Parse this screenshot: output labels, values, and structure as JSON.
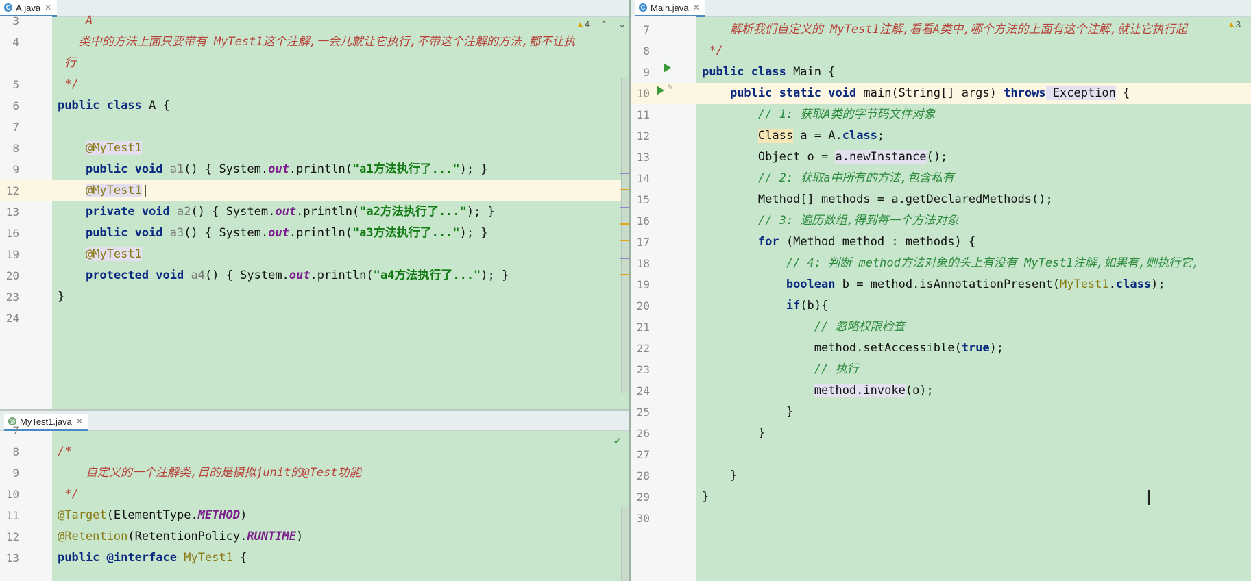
{
  "left_top": {
    "tab": {
      "label": "A.java",
      "icon": "C"
    },
    "warnings": "4",
    "lines": [
      {
        "n": "3",
        "segments": [
          {
            "t": "    A",
            "c": "cm"
          }
        ]
      },
      {
        "n": "4",
        "segments": [
          {
            "t": "   类中的方法上面只要带有 MyTest1这个注解,一会儿就让它执行,不带这个注解的方法,都不让执",
            "c": "cm"
          }
        ]
      },
      {
        "n": "",
        "segments": [
          {
            "t": " 行",
            "c": "cm"
          }
        ]
      },
      {
        "n": "5",
        "segments": [
          {
            "t": " */",
            "c": "cm"
          }
        ]
      },
      {
        "n": "6",
        "segments": [
          {
            "t": "public class",
            "c": "kw"
          },
          {
            "t": " A {",
            "c": ""
          }
        ]
      },
      {
        "n": "7",
        "segments": [
          {
            "t": "",
            "c": ""
          }
        ]
      },
      {
        "n": "8",
        "segments": [
          {
            "t": "    ",
            "c": ""
          },
          {
            "t": "@MyTest1",
            "c": "annbg"
          }
        ]
      },
      {
        "n": "9",
        "segments": [
          {
            "t": "    ",
            "c": ""
          },
          {
            "t": "public void",
            "c": "kw"
          },
          {
            "t": " a1",
            "c": "gray"
          },
          {
            "t": "() { System.",
            "c": ""
          },
          {
            "t": "out",
            "c": "fld"
          },
          {
            "t": ".println(",
            "c": ""
          },
          {
            "t": "\"a1方法执行了...\"",
            "c": "str"
          },
          {
            "t": "); }",
            "c": ""
          }
        ]
      },
      {
        "n": "12",
        "segments": [
          {
            "t": "    ",
            "c": ""
          },
          {
            "t": "@MyTest1",
            "c": "annbg"
          },
          {
            "t": "|",
            "c": ""
          }
        ]
      },
      {
        "n": "13",
        "segments": [
          {
            "t": "    ",
            "c": ""
          },
          {
            "t": "private void",
            "c": "kw"
          },
          {
            "t": " a2",
            "c": "gray"
          },
          {
            "t": "() { System.",
            "c": ""
          },
          {
            "t": "out",
            "c": "fld"
          },
          {
            "t": ".println(",
            "c": ""
          },
          {
            "t": "\"a2方法执行了...\"",
            "c": "str"
          },
          {
            "t": "); }",
            "c": ""
          }
        ]
      },
      {
        "n": "16",
        "segments": [
          {
            "t": "    ",
            "c": ""
          },
          {
            "t": "public void",
            "c": "kw"
          },
          {
            "t": " a3",
            "c": "gray"
          },
          {
            "t": "() { System.",
            "c": ""
          },
          {
            "t": "out",
            "c": "fld"
          },
          {
            "t": ".println(",
            "c": ""
          },
          {
            "t": "\"a3方法执行了...\"",
            "c": "str"
          },
          {
            "t": "); }",
            "c": ""
          }
        ]
      },
      {
        "n": "19",
        "segments": [
          {
            "t": "    ",
            "c": ""
          },
          {
            "t": "@MyTest1",
            "c": "annbg"
          }
        ]
      },
      {
        "n": "20",
        "segments": [
          {
            "t": "    ",
            "c": ""
          },
          {
            "t": "protected void",
            "c": "kw"
          },
          {
            "t": " a4",
            "c": "gray"
          },
          {
            "t": "() { System.",
            "c": ""
          },
          {
            "t": "out",
            "c": "fld"
          },
          {
            "t": ".println(",
            "c": ""
          },
          {
            "t": "\"a4方法执行了...\"",
            "c": "str"
          },
          {
            "t": "); }",
            "c": ""
          }
        ]
      },
      {
        "n": "23",
        "segments": [
          {
            "t": "}",
            "c": ""
          }
        ]
      },
      {
        "n": "24",
        "segments": [
          {
            "t": "",
            "c": ""
          }
        ]
      }
    ]
  },
  "left_bottom": {
    "tab": {
      "label": "MyTest1.java",
      "icon": "@"
    },
    "lines": [
      {
        "n": "7",
        "segments": [
          {
            "t": "",
            "c": ""
          }
        ]
      },
      {
        "n": "8",
        "segments": [
          {
            "t": "/*",
            "c": "cm"
          }
        ]
      },
      {
        "n": "9",
        "segments": [
          {
            "t": "    自定义的一个注解类,目的是模拟junit的@Test功能",
            "c": "cm"
          }
        ]
      },
      {
        "n": "10",
        "segments": [
          {
            "t": " */",
            "c": "cm"
          }
        ]
      },
      {
        "n": "11",
        "segments": [
          {
            "t": "@Target",
            "c": "ann"
          },
          {
            "t": "(ElementType.",
            "c": ""
          },
          {
            "t": "METHOD",
            "c": "fld"
          },
          {
            "t": ")",
            "c": ""
          }
        ]
      },
      {
        "n": "12",
        "segments": [
          {
            "t": "@Retention",
            "c": "ann"
          },
          {
            "t": "(RetentionPolicy.",
            "c": ""
          },
          {
            "t": "RUNTIME",
            "c": "fld"
          },
          {
            "t": ")",
            "c": ""
          }
        ]
      },
      {
        "n": "13",
        "segments": [
          {
            "t": "public",
            "c": "kw"
          },
          {
            "t": " @interface",
            "c": "kw"
          },
          {
            "t": " MyTest1",
            "c": "ann"
          },
          {
            "t": " {",
            "c": ""
          }
        ]
      }
    ]
  },
  "right": {
    "tab": {
      "label": "Main.java",
      "icon": "C"
    },
    "warnings": "3",
    "lines": [
      {
        "n": "7",
        "segments": [
          {
            "t": "    解析我们自定义的 MyTest1注解,看看A类中,哪个方法的上面有这个注解,就让它执行起",
            "c": "cm"
          }
        ]
      },
      {
        "n": "8",
        "segments": [
          {
            "t": " */",
            "c": "cm"
          }
        ]
      },
      {
        "n": "9",
        "segments": [
          {
            "t": "public class",
            "c": "kw"
          },
          {
            "t": " Main {",
            "c": ""
          }
        ]
      },
      {
        "n": "10",
        "segments": [
          {
            "t": "    ",
            "c": ""
          },
          {
            "t": "public static void",
            "c": "kw"
          },
          {
            "t": " main(String[] args) ",
            "c": ""
          },
          {
            "t": "throws",
            "c": "kw"
          },
          {
            "t": " Exception",
            "c": "lilac"
          },
          {
            "t": " {",
            "c": ""
          }
        ]
      },
      {
        "n": "11",
        "segments": [
          {
            "t": "        ",
            "c": ""
          },
          {
            "t": "// 1: 获取A类的字节码文件对象",
            "c": "gc"
          }
        ]
      },
      {
        "n": "12",
        "segments": [
          {
            "t": "        ",
            "c": ""
          },
          {
            "t": "Class",
            "c": "warnbg"
          },
          {
            "t": " a = A.",
            "c": ""
          },
          {
            "t": "class",
            "c": "kw"
          },
          {
            "t": ";",
            "c": ""
          }
        ]
      },
      {
        "n": "13",
        "segments": [
          {
            "t": "        Object o = ",
            "c": ""
          },
          {
            "t": "a.newInstance",
            "c": "lilac"
          },
          {
            "t": "();",
            "c": ""
          }
        ]
      },
      {
        "n": "14",
        "segments": [
          {
            "t": "        ",
            "c": ""
          },
          {
            "t": "// 2: 获取a中所有的方法,包含私有",
            "c": "gc"
          }
        ]
      },
      {
        "n": "15",
        "segments": [
          {
            "t": "        Method[] methods = a.getDeclaredMethods();",
            "c": ""
          }
        ]
      },
      {
        "n": "16",
        "segments": [
          {
            "t": "        ",
            "c": ""
          },
          {
            "t": "// 3: 遍历数组,得到每一个方法对象",
            "c": "gc"
          }
        ]
      },
      {
        "n": "17",
        "segments": [
          {
            "t": "        ",
            "c": ""
          },
          {
            "t": "for",
            "c": "kw"
          },
          {
            "t": " (Method method : methods) {",
            "c": ""
          }
        ]
      },
      {
        "n": "18",
        "segments": [
          {
            "t": "            ",
            "c": ""
          },
          {
            "t": "// 4: 判断 method方法对象的头上有没有 MyTest1注解,如果有,则执行它,",
            "c": "gc"
          }
        ]
      },
      {
        "n": "19",
        "segments": [
          {
            "t": "            ",
            "c": ""
          },
          {
            "t": "boolean",
            "c": "kw"
          },
          {
            "t": " b = method.isAnnotationPresent(",
            "c": ""
          },
          {
            "t": "MyTest1",
            "c": "ann"
          },
          {
            "t": ".",
            "c": ""
          },
          {
            "t": "class",
            "c": "kw"
          },
          {
            "t": ");",
            "c": ""
          }
        ]
      },
      {
        "n": "20",
        "segments": [
          {
            "t": "            ",
            "c": ""
          },
          {
            "t": "if",
            "c": "kw"
          },
          {
            "t": "(b){",
            "c": ""
          }
        ]
      },
      {
        "n": "21",
        "segments": [
          {
            "t": "                ",
            "c": ""
          },
          {
            "t": "// 忽略权限检查",
            "c": "gc"
          }
        ]
      },
      {
        "n": "22",
        "segments": [
          {
            "t": "                method.setAccessible(",
            "c": ""
          },
          {
            "t": "true",
            "c": "kw"
          },
          {
            "t": ");",
            "c": ""
          }
        ]
      },
      {
        "n": "23",
        "segments": [
          {
            "t": "                ",
            "c": ""
          },
          {
            "t": "// 执行",
            "c": "gc"
          }
        ]
      },
      {
        "n": "24",
        "segments": [
          {
            "t": "                ",
            "c": ""
          },
          {
            "t": "method.invoke",
            "c": "lilac"
          },
          {
            "t": "(o);",
            "c": ""
          }
        ]
      },
      {
        "n": "25",
        "segments": [
          {
            "t": "            }",
            "c": ""
          }
        ]
      },
      {
        "n": "26",
        "segments": [
          {
            "t": "        }",
            "c": ""
          }
        ]
      },
      {
        "n": "27",
        "segments": [
          {
            "t": "",
            "c": ""
          }
        ]
      },
      {
        "n": "28",
        "segments": [
          {
            "t": "    }",
            "c": ""
          }
        ]
      },
      {
        "n": "29",
        "segments": [
          {
            "t": "}",
            "c": ""
          }
        ]
      },
      {
        "n": "30",
        "segments": [
          {
            "t": "",
            "c": ""
          }
        ]
      }
    ]
  },
  "colors": {
    "editor_bg": "#c7e6cc",
    "keyword": "#0b2a80",
    "comment": "#b8413a",
    "string": "#127a12",
    "annotation": "#8a7a12"
  }
}
